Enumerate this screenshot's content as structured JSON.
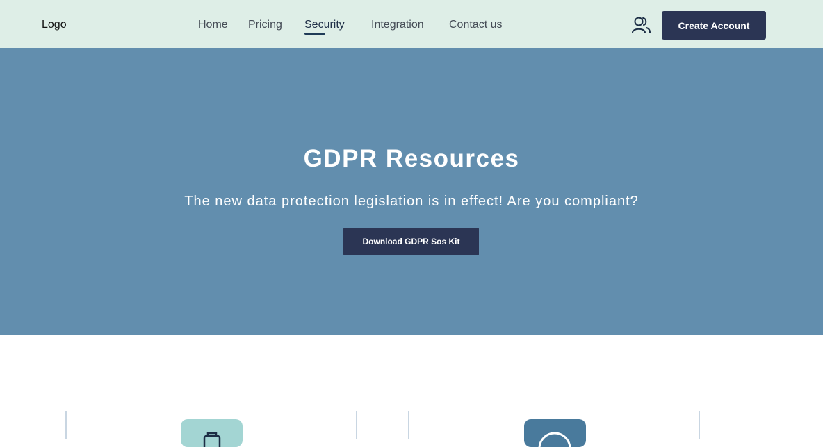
{
  "header": {
    "logo": "Logo",
    "nav": [
      {
        "label": "Home"
      },
      {
        "label": "Pricing"
      },
      {
        "label": "Security",
        "active": true
      },
      {
        "label": "Integration"
      },
      {
        "label": "Contact us"
      }
    ],
    "user_icon": "user-group-icon",
    "create_account_label": "Create Account"
  },
  "hero": {
    "title": "GDPR Resources",
    "subtitle": "The new data protection legislation is in effect! Are you compliant?",
    "download_label": "Download GDPR Sos Kit"
  },
  "features": {
    "icons": [
      "briefcase-icon",
      "shield-icon"
    ]
  },
  "colors": {
    "nav_bg": "#deeee7",
    "hero_bg": "#628eae",
    "button_bg": "#2b3554",
    "badge_teal": "#a3d5d3",
    "badge_blue": "#497a9c"
  }
}
